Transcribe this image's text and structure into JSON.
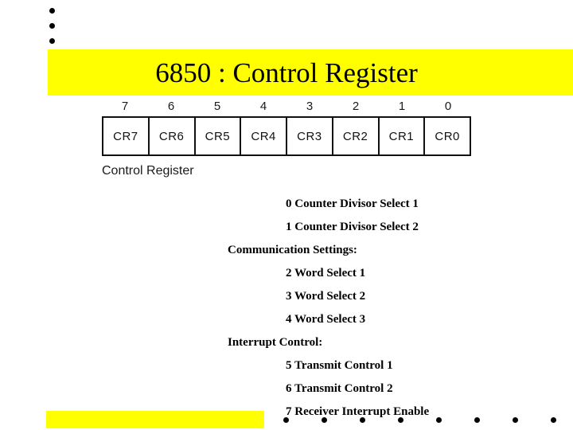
{
  "slide": {
    "title": "6850 : Control Register",
    "title_banner_color": "#ffff00",
    "background_color": "#ffffff",
    "text_color": "#000000"
  },
  "top_bullets": [
    {
      "name": "bullet-dot-1"
    },
    {
      "name": "bullet-dot-2"
    },
    {
      "name": "bullet-dot-3"
    }
  ],
  "register_diagram": {
    "bit_numbers": [
      "7",
      "6",
      "5",
      "4",
      "3",
      "2",
      "1",
      "0"
    ],
    "cells": [
      "CR7",
      "CR6",
      "CR5",
      "CR4",
      "CR3",
      "CR2",
      "CR1",
      "CR0"
    ],
    "caption": "Control Register"
  },
  "descriptions": [
    {
      "text": "0 Counter Divisor Select 1",
      "level": "item"
    },
    {
      "text": "1 Counter Divisor Select 2",
      "level": "item"
    },
    {
      "text": "Communication Settings:",
      "level": "head"
    },
    {
      "text": "2 Word Select 1",
      "level": "item"
    },
    {
      "text": "3 Word Select 2",
      "level": "item"
    },
    {
      "text": "4 Word Select 3",
      "level": "item"
    },
    {
      "text": "Interrupt Control:",
      "level": "head"
    },
    {
      "text": "5 Transmit Control 1",
      "level": "item"
    },
    {
      "text": "6 Transmit Control 2",
      "level": "item"
    },
    {
      "text": "7 Receiver Interrupt Enable",
      "level": "item"
    }
  ],
  "footer": {
    "bar_color": "#ffff00",
    "dot_count": 8,
    "dot_spacing": 48
  }
}
